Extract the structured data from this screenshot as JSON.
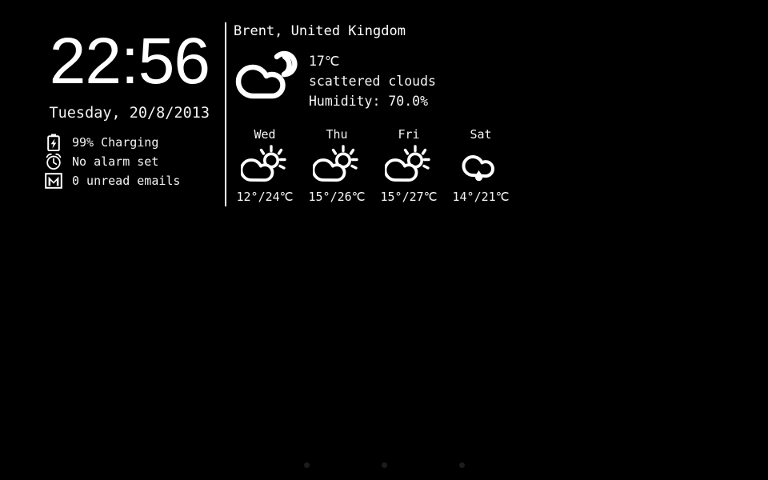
{
  "screen": {
    "background_color": "#000000",
    "foreground_color": "#ffffff"
  },
  "clock": {
    "time": "22:56",
    "date": "Tuesday, 20/8/2013"
  },
  "status": {
    "items": [
      {
        "icon": "battery-charging-icon",
        "text": "99% Charging"
      },
      {
        "icon": "alarm-clock-icon",
        "text": "No alarm set"
      },
      {
        "icon": "gmail-envelope-icon",
        "text": "0 unread emails"
      }
    ]
  },
  "weather": {
    "location": "Brent, United Kingdom",
    "icon": "cloud-with-sun-icon",
    "temperature": "17℃",
    "condition": "scattered clouds",
    "humidity": "Humidity: 70.0%",
    "forecast": [
      {
        "day": "Wed",
        "icon": "partly-cloudy-icon",
        "temps": "12°/24℃"
      },
      {
        "day": "Thu",
        "icon": "partly-cloudy-icon",
        "temps": "15°/26℃"
      },
      {
        "day": "Fri",
        "icon": "partly-cloudy-icon",
        "temps": "15°/27℃"
      },
      {
        "day": "Sat",
        "icon": "rain-cloud-icon",
        "temps": "14°/21℃"
      }
    ]
  },
  "page_indicator": {
    "dots": 3,
    "color": "#1c1c1c"
  }
}
